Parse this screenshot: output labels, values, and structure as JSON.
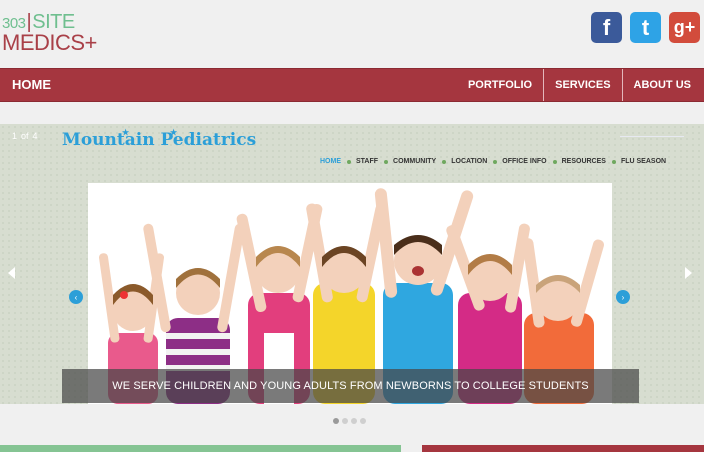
{
  "logo": {
    "line1_num": "303",
    "line1_word": "SITE",
    "line2": "MEDICS+"
  },
  "social": [
    {
      "name": "facebook-icon",
      "glyph": "f"
    },
    {
      "name": "twitter-icon",
      "glyph": "t"
    },
    {
      "name": "googleplus-icon",
      "glyph": "g+"
    }
  ],
  "nav": {
    "home": "HOME",
    "items": [
      "PORTFOLIO",
      "SERVICES",
      "ABOUT US"
    ]
  },
  "slider": {
    "counter_current": "1",
    "counter_of": "of",
    "counter_total": "4",
    "site_title": "Mountain Pediatrics",
    "submenu": [
      "HOME",
      "STAFF",
      "COMMUNITY",
      "LOCATION",
      "OFFICE INFO",
      "RESOURCES",
      "FLU SEASON"
    ],
    "caption": "WE SERVE CHILDREN AND YOUNG ADULTS FROM NEWBORNS TO COLLEGE STUDENTS",
    "dots_count": 4,
    "active_dot": 0
  },
  "colors": {
    "nav": "#a5363f",
    "accent_blue": "#2c9fd8",
    "logo_green": "#6fbf8f"
  }
}
